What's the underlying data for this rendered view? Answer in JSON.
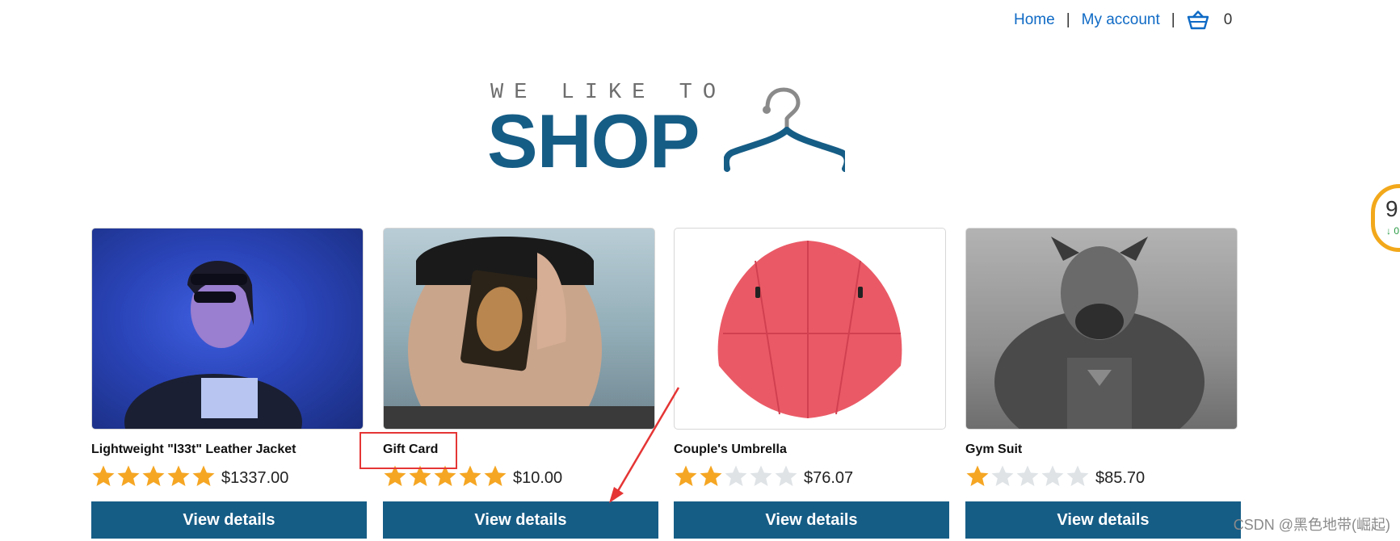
{
  "nav": {
    "home": "Home",
    "account": "My account",
    "separator": "|",
    "cart_count": "0",
    "cart_icon": "basket-icon"
  },
  "logo": {
    "tagline": "WE LIKE TO",
    "word": "SHOP",
    "icon": "hanger-icon"
  },
  "products": [
    {
      "title": "Lightweight \"l33t\" Leather Jacket",
      "price": "$1337.00",
      "rating": 5,
      "button": "View details",
      "image": "person-with-headphones"
    },
    {
      "title": "Gift Card",
      "price": "$10.00",
      "rating": 5,
      "button": "View details",
      "image": "person-holding-card"
    },
    {
      "title": "Couple's Umbrella",
      "price": "$76.07",
      "rating": 2,
      "button": "View details",
      "image": "red-umbrella"
    },
    {
      "title": "Gym Suit",
      "price": "$85.70",
      "rating": 1,
      "button": "View details",
      "image": "bodybuilder-dog"
    }
  ],
  "widget": {
    "number": "9",
    "delta": "↓ 0"
  },
  "watermark": "CSDN @黑色地带(崛起)",
  "colors": {
    "brand": "#165d86",
    "link": "#0f6ac5",
    "star_on": "#f5a623",
    "star_off": "#dfe3e6",
    "annotation": "#e53535"
  }
}
